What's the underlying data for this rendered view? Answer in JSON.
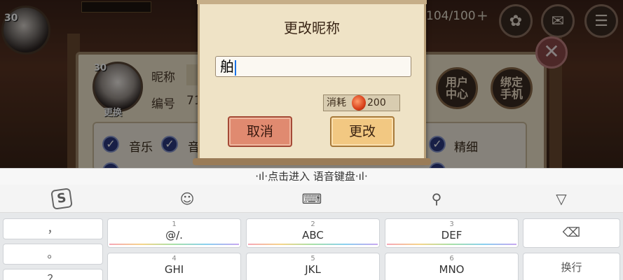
{
  "game": {
    "player_level_top": "30",
    "stamina": "104/100",
    "profile": {
      "level": "30",
      "change_label": "更换",
      "nickname_label": "昵称",
      "id_label": "编号",
      "id_value_partial": "71"
    },
    "buttons": {
      "user_center": "用户中心",
      "bind_phone": "绑定手机"
    },
    "settings": {
      "music": "音乐",
      "sound_partial": "音",
      "fine": "精细"
    }
  },
  "dialog": {
    "title": "更改昵称",
    "input_value": "舶",
    "cost_label": "消耗",
    "cost_value": "200",
    "cancel_label": "取消",
    "confirm_label": "更改"
  },
  "keyboard": {
    "voice_hint": "·ıl·点击进入 语音键盘·ıl·",
    "left_keys": [
      "，",
      "。",
      "？"
    ],
    "keys": [
      {
        "num": "1",
        "label": "@/."
      },
      {
        "num": "2",
        "label": "ABC"
      },
      {
        "num": "3",
        "label": "DEF"
      },
      {
        "num": "4",
        "label": "GHI"
      },
      {
        "num": "5",
        "label": "JKL"
      },
      {
        "num": "6",
        "label": "MNO"
      }
    ],
    "backspace_icon": "⌫",
    "enter_label": "换行"
  },
  "colors": {
    "dialog_bg": "#efe3c6",
    "cancel_btn": "#e08a70",
    "confirm_btn": "#f2c882",
    "checkbox": "#2c3a80"
  }
}
